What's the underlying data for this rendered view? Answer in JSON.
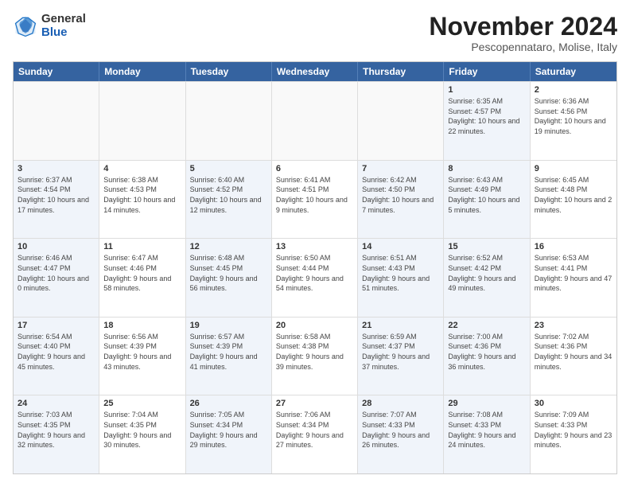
{
  "header": {
    "logo_general": "General",
    "logo_blue": "Blue",
    "month_title": "November 2024",
    "location": "Pescopennataro, Molise, Italy"
  },
  "weekdays": [
    "Sunday",
    "Monday",
    "Tuesday",
    "Wednesday",
    "Thursday",
    "Friday",
    "Saturday"
  ],
  "rows": [
    [
      {
        "day": "",
        "info": "",
        "empty": true
      },
      {
        "day": "",
        "info": "",
        "empty": true
      },
      {
        "day": "",
        "info": "",
        "empty": true
      },
      {
        "day": "",
        "info": "",
        "empty": true
      },
      {
        "day": "",
        "info": "",
        "empty": true
      },
      {
        "day": "1",
        "info": "Sunrise: 6:35 AM\nSunset: 4:57 PM\nDaylight: 10 hours and 22 minutes.",
        "empty": false,
        "shaded": true
      },
      {
        "day": "2",
        "info": "Sunrise: 6:36 AM\nSunset: 4:56 PM\nDaylight: 10 hours and 19 minutes.",
        "empty": false
      }
    ],
    [
      {
        "day": "3",
        "info": "Sunrise: 6:37 AM\nSunset: 4:54 PM\nDaylight: 10 hours and 17 minutes.",
        "empty": false,
        "shaded": true
      },
      {
        "day": "4",
        "info": "Sunrise: 6:38 AM\nSunset: 4:53 PM\nDaylight: 10 hours and 14 minutes.",
        "empty": false
      },
      {
        "day": "5",
        "info": "Sunrise: 6:40 AM\nSunset: 4:52 PM\nDaylight: 10 hours and 12 minutes.",
        "empty": false,
        "shaded": true
      },
      {
        "day": "6",
        "info": "Sunrise: 6:41 AM\nSunset: 4:51 PM\nDaylight: 10 hours and 9 minutes.",
        "empty": false
      },
      {
        "day": "7",
        "info": "Sunrise: 6:42 AM\nSunset: 4:50 PM\nDaylight: 10 hours and 7 minutes.",
        "empty": false,
        "shaded": true
      },
      {
        "day": "8",
        "info": "Sunrise: 6:43 AM\nSunset: 4:49 PM\nDaylight: 10 hours and 5 minutes.",
        "empty": false,
        "shaded": true
      },
      {
        "day": "9",
        "info": "Sunrise: 6:45 AM\nSunset: 4:48 PM\nDaylight: 10 hours and 2 minutes.",
        "empty": false
      }
    ],
    [
      {
        "day": "10",
        "info": "Sunrise: 6:46 AM\nSunset: 4:47 PM\nDaylight: 10 hours and 0 minutes.",
        "empty": false,
        "shaded": true
      },
      {
        "day": "11",
        "info": "Sunrise: 6:47 AM\nSunset: 4:46 PM\nDaylight: 9 hours and 58 minutes.",
        "empty": false
      },
      {
        "day": "12",
        "info": "Sunrise: 6:48 AM\nSunset: 4:45 PM\nDaylight: 9 hours and 56 minutes.",
        "empty": false,
        "shaded": true
      },
      {
        "day": "13",
        "info": "Sunrise: 6:50 AM\nSunset: 4:44 PM\nDaylight: 9 hours and 54 minutes.",
        "empty": false
      },
      {
        "day": "14",
        "info": "Sunrise: 6:51 AM\nSunset: 4:43 PM\nDaylight: 9 hours and 51 minutes.",
        "empty": false,
        "shaded": true
      },
      {
        "day": "15",
        "info": "Sunrise: 6:52 AM\nSunset: 4:42 PM\nDaylight: 9 hours and 49 minutes.",
        "empty": false,
        "shaded": true
      },
      {
        "day": "16",
        "info": "Sunrise: 6:53 AM\nSunset: 4:41 PM\nDaylight: 9 hours and 47 minutes.",
        "empty": false
      }
    ],
    [
      {
        "day": "17",
        "info": "Sunrise: 6:54 AM\nSunset: 4:40 PM\nDaylight: 9 hours and 45 minutes.",
        "empty": false,
        "shaded": true
      },
      {
        "day": "18",
        "info": "Sunrise: 6:56 AM\nSunset: 4:39 PM\nDaylight: 9 hours and 43 minutes.",
        "empty": false
      },
      {
        "day": "19",
        "info": "Sunrise: 6:57 AM\nSunset: 4:39 PM\nDaylight: 9 hours and 41 minutes.",
        "empty": false,
        "shaded": true
      },
      {
        "day": "20",
        "info": "Sunrise: 6:58 AM\nSunset: 4:38 PM\nDaylight: 9 hours and 39 minutes.",
        "empty": false
      },
      {
        "day": "21",
        "info": "Sunrise: 6:59 AM\nSunset: 4:37 PM\nDaylight: 9 hours and 37 minutes.",
        "empty": false,
        "shaded": true
      },
      {
        "day": "22",
        "info": "Sunrise: 7:00 AM\nSunset: 4:36 PM\nDaylight: 9 hours and 36 minutes.",
        "empty": false,
        "shaded": true
      },
      {
        "day": "23",
        "info": "Sunrise: 7:02 AM\nSunset: 4:36 PM\nDaylight: 9 hours and 34 minutes.",
        "empty": false
      }
    ],
    [
      {
        "day": "24",
        "info": "Sunrise: 7:03 AM\nSunset: 4:35 PM\nDaylight: 9 hours and 32 minutes.",
        "empty": false,
        "shaded": true
      },
      {
        "day": "25",
        "info": "Sunrise: 7:04 AM\nSunset: 4:35 PM\nDaylight: 9 hours and 30 minutes.",
        "empty": false
      },
      {
        "day": "26",
        "info": "Sunrise: 7:05 AM\nSunset: 4:34 PM\nDaylight: 9 hours and 29 minutes.",
        "empty": false,
        "shaded": true
      },
      {
        "day": "27",
        "info": "Sunrise: 7:06 AM\nSunset: 4:34 PM\nDaylight: 9 hours and 27 minutes.",
        "empty": false
      },
      {
        "day": "28",
        "info": "Sunrise: 7:07 AM\nSunset: 4:33 PM\nDaylight: 9 hours and 26 minutes.",
        "empty": false,
        "shaded": true
      },
      {
        "day": "29",
        "info": "Sunrise: 7:08 AM\nSunset: 4:33 PM\nDaylight: 9 hours and 24 minutes.",
        "empty": false,
        "shaded": true
      },
      {
        "day": "30",
        "info": "Sunrise: 7:09 AM\nSunset: 4:33 PM\nDaylight: 9 hours and 23 minutes.",
        "empty": false
      }
    ]
  ]
}
